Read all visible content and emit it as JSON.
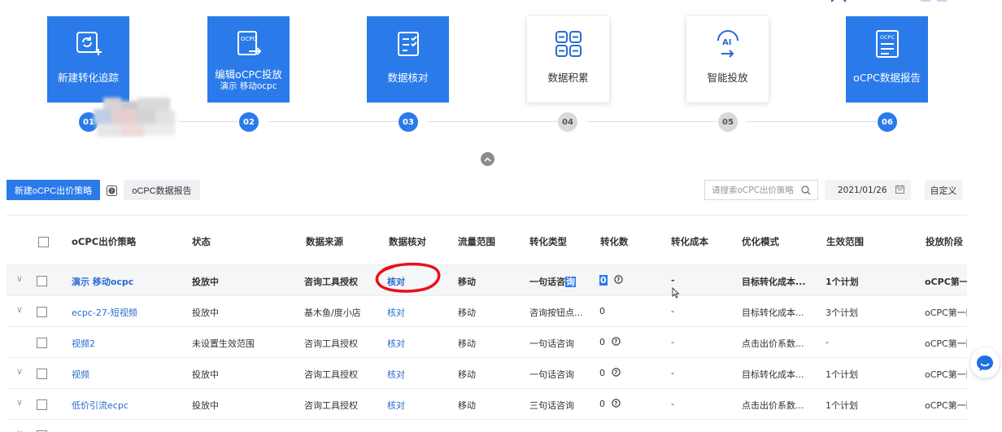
{
  "steps": [
    {
      "title": "新建转化追踪",
      "sub": "",
      "num": "01",
      "state": "blue",
      "icon": "refresh-plus-icon"
    },
    {
      "title": "编辑oCPC投放",
      "sub": "演示 移动ocpc",
      "num": "02",
      "state": "blue",
      "icon": "ocpc-doc-arrow-icon"
    },
    {
      "title": "数据核对",
      "sub": "",
      "num": "03",
      "state": "blue",
      "icon": "checklist-icon"
    },
    {
      "title": "数据积累",
      "sub": "",
      "num": "04",
      "state": "gray",
      "icon": "grid-icon"
    },
    {
      "title": "智能投放",
      "sub": "",
      "num": "05",
      "state": "gray",
      "icon": "ai-arrow-icon"
    },
    {
      "title": "oCPC数据报告",
      "sub": "",
      "num": "06",
      "state": "blue",
      "icon": "ocpc-report-icon"
    }
  ],
  "toolbar": {
    "new_strategy_label": "新建oCPC出价策略",
    "report_label": "oCPC数据报告",
    "search_placeholder": "请搜索oCPC出价策略",
    "date_value": "2021/01/26",
    "custom_label": "自定义"
  },
  "table": {
    "headers": [
      "oCPC出价策略",
      "状态",
      "数据来源",
      "数据核对",
      "流量范围",
      "转化类型",
      "转化数",
      "转化成本",
      "优化模式",
      "生效范围",
      "投放阶段"
    ],
    "rows": [
      {
        "name": "演示 移动ocpc",
        "status": "投放中",
        "source": "咨询工具授权",
        "check": "核对",
        "traffic": "移动",
        "conv_type_a": "一句话咨",
        "conv_type_b": "询",
        "conv_count": "0",
        "cost": "-",
        "mode": "目标转化成本...",
        "scope": "1个计划",
        "stage": "oCPC第一阶"
      },
      {
        "name": "ecpc-27-短视频",
        "status": "投放中",
        "source": "基木鱼/度小店",
        "check": "核对",
        "traffic": "移动",
        "conv_type": "咨询按钮点...",
        "conv_count": "0",
        "cost": "-",
        "mode": "目标转化成本...",
        "scope": "3个计划",
        "stage": "oCPC第一阶"
      },
      {
        "name": "视频2",
        "status": "未设置生效范围",
        "source": "咨询工具授权",
        "check": "核对",
        "traffic": "移动",
        "conv_type": "一句话咨询",
        "conv_count": "0",
        "cost": "-",
        "mode": "点击出价系数...",
        "scope": "-",
        "stage": "oCPC第一阶"
      },
      {
        "name": "视频",
        "status": "投放中",
        "source": "咨询工具授权",
        "check": "核对",
        "traffic": "移动",
        "conv_type": "一句话咨询",
        "conv_count": "0",
        "cost": "-",
        "mode": "目标转化成本...",
        "scope": "1个计划",
        "stage": "oCPC第一阶"
      },
      {
        "name": "低价引流ecpc",
        "status": "投放中",
        "source": "咨询工具授权",
        "check": "核对",
        "traffic": "移动",
        "conv_type": "三句话咨询",
        "conv_count": "0",
        "cost": "-",
        "mode": "点击出价系数...",
        "scope": "1个计划",
        "stage": "oCPC第一阶"
      }
    ]
  },
  "colors": {
    "accent": "#2a7ae9",
    "link": "#2a6ad1",
    "annotation": "#e8101a"
  }
}
